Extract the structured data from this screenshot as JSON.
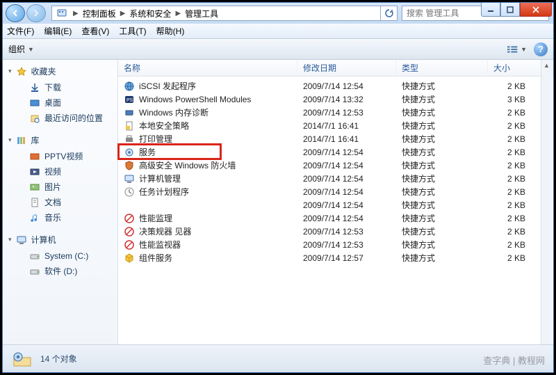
{
  "breadcrumbs": [
    "控制面板",
    "系统和安全",
    "管理工具"
  ],
  "search": {
    "placeholder": "搜索 管理工具"
  },
  "menubar": {
    "file": "文件(F)",
    "edit": "编辑(E)",
    "view": "查看(V)",
    "tools": "工具(T)",
    "help": "帮助(H)"
  },
  "toolbar": {
    "organize": "组织"
  },
  "sidebar": {
    "favorites": {
      "label": "收藏夹",
      "items": [
        "下载",
        "桌面",
        "最近访问的位置"
      ]
    },
    "libraries": {
      "label": "库",
      "items": [
        "PPTV视频",
        "视频",
        "图片",
        "文档",
        "音乐"
      ]
    },
    "computer": {
      "label": "计算机",
      "items": [
        "System (C:)",
        "软件 (D:)"
      ]
    }
  },
  "columns": {
    "name": "名称",
    "date": "修改日期",
    "type": "类型",
    "size": "大小"
  },
  "items": [
    {
      "icon": "globe",
      "name": "iSCSI 发起程序",
      "date": "2009/7/14 12:54",
      "type": "快捷方式",
      "size": "2 KB"
    },
    {
      "icon": "ps",
      "name": "Windows PowerShell Modules",
      "date": "2009/7/14 13:32",
      "type": "快捷方式",
      "size": "3 KB"
    },
    {
      "icon": "mem",
      "name": "Windows 内存诊断",
      "date": "2009/7/14 12:53",
      "type": "快捷方式",
      "size": "2 KB"
    },
    {
      "icon": "policy",
      "name": "本地安全策略",
      "date": "2014/7/1 16:41",
      "type": "快捷方式",
      "size": "2 KB"
    },
    {
      "icon": "printer",
      "name": "打印管理",
      "date": "2014/7/1 16:41",
      "type": "快捷方式",
      "size": "2 KB"
    },
    {
      "icon": "gear",
      "name": "服务",
      "hl": true,
      "date": "2009/7/14 12:54",
      "type": "快捷方式",
      "size": "2 KB"
    },
    {
      "icon": "shield",
      "name": "高级安全 Windows 防火墙",
      "date": "2009/7/14 12:54",
      "type": "快捷方式",
      "size": "2 KB"
    },
    {
      "icon": "pc",
      "name": "计算机管理",
      "date": "2009/7/14 12:54",
      "type": "快捷方式",
      "size": "2 KB"
    },
    {
      "icon": "clock",
      "name": "任务计划程序",
      "date": "2009/7/14 12:54",
      "type": "快捷方式",
      "size": "2 KB"
    },
    {
      "icon": "blank",
      "name": "",
      "date": "2009/7/14 12:54",
      "type": "快捷方式",
      "size": "2 KB"
    },
    {
      "icon": "forbid",
      "name": "性能监理",
      "date": "2009/7/14 12:54",
      "type": "快捷方式",
      "size": "2 KB"
    },
    {
      "icon": "forbid",
      "name": "决策规器     见器",
      "date": "2009/7/14 12:53",
      "type": "快捷方式",
      "size": "2 KB"
    },
    {
      "icon": "forbid",
      "name": "性能监视器",
      "date": "2009/7/14 12:53",
      "type": "快捷方式",
      "size": "2 KB"
    },
    {
      "icon": "cube",
      "name": "组件服务",
      "date": "2009/7/14 12:57",
      "type": "快捷方式",
      "size": "2 KB"
    }
  ],
  "status": {
    "count": "14 个对象"
  },
  "watermark": "查字典 | 教程网"
}
